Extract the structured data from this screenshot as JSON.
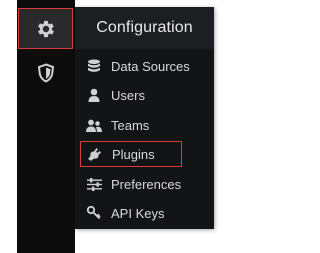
{
  "sidebar": {
    "items": [
      {
        "icon": "gear-icon",
        "selected": true
      },
      {
        "icon": "shield-icon",
        "selected": false
      }
    ]
  },
  "menu": {
    "header": "Configuration",
    "items": [
      {
        "label": "Data Sources",
        "icon": "database-icon"
      },
      {
        "label": "Users",
        "icon": "user-icon"
      },
      {
        "label": "Teams",
        "icon": "users-icon"
      },
      {
        "label": "Plugins",
        "icon": "plug-icon",
        "highlighted": true
      },
      {
        "label": "Preferences",
        "icon": "sliders-icon"
      },
      {
        "label": "API Keys",
        "icon": "key-icon"
      }
    ]
  },
  "colors": {
    "highlight_border": "#d93b3b",
    "menu_bg": "#131416",
    "sidebar_bg": "#0c0c0d"
  }
}
